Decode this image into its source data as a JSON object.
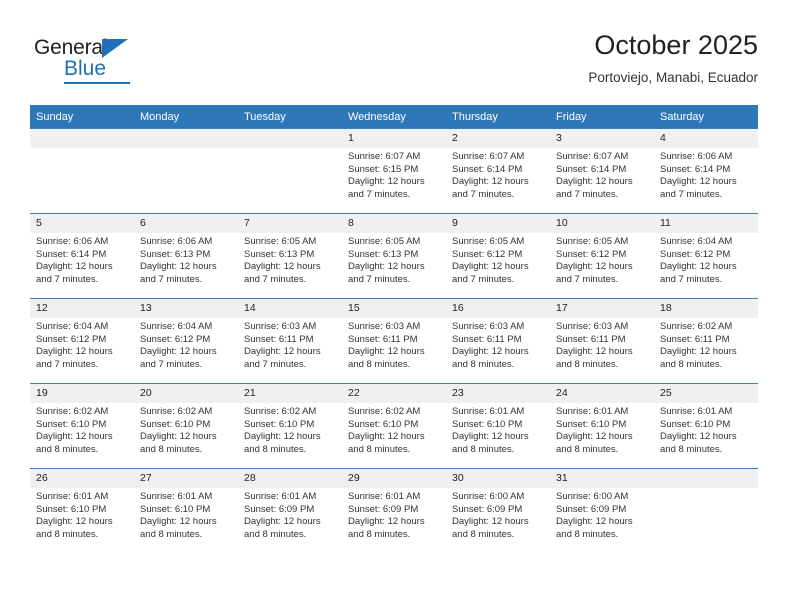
{
  "brand": {
    "word_one": "General",
    "word_two": "Blue",
    "accent_color": "#1f70b8"
  },
  "header": {
    "title": "October 2025",
    "subtitle": "Portoviejo, Manabi, Ecuador"
  },
  "theme": {
    "header_row_bg": "#2e77b9",
    "daynum_bg": "#f0f0f0",
    "text_color": "#333333"
  },
  "labels": {
    "sunrise_prefix": "Sunrise:",
    "sunset_prefix": "Sunset:",
    "daylight_prefix": "Daylight:"
  },
  "weekdays": [
    "Sunday",
    "Monday",
    "Tuesday",
    "Wednesday",
    "Thursday",
    "Friday",
    "Saturday"
  ],
  "weeks": [
    [
      {
        "day": "",
        "blank": true,
        "sunrise": "",
        "sunset": "",
        "daylight": ""
      },
      {
        "day": "",
        "blank": true,
        "sunrise": "",
        "sunset": "",
        "daylight": ""
      },
      {
        "day": "",
        "blank": true,
        "sunrise": "",
        "sunset": "",
        "daylight": ""
      },
      {
        "day": "1",
        "blank": false,
        "sunrise": "Sunrise: 6:07 AM",
        "sunset": "Sunset: 6:15 PM",
        "daylight": "Daylight: 12 hours and 7 minutes."
      },
      {
        "day": "2",
        "blank": false,
        "sunrise": "Sunrise: 6:07 AM",
        "sunset": "Sunset: 6:14 PM",
        "daylight": "Daylight: 12 hours and 7 minutes."
      },
      {
        "day": "3",
        "blank": false,
        "sunrise": "Sunrise: 6:07 AM",
        "sunset": "Sunset: 6:14 PM",
        "daylight": "Daylight: 12 hours and 7 minutes."
      },
      {
        "day": "4",
        "blank": false,
        "sunrise": "Sunrise: 6:06 AM",
        "sunset": "Sunset: 6:14 PM",
        "daylight": "Daylight: 12 hours and 7 minutes."
      }
    ],
    [
      {
        "day": "5",
        "blank": false,
        "sunrise": "Sunrise: 6:06 AM",
        "sunset": "Sunset: 6:14 PM",
        "daylight": "Daylight: 12 hours and 7 minutes."
      },
      {
        "day": "6",
        "blank": false,
        "sunrise": "Sunrise: 6:06 AM",
        "sunset": "Sunset: 6:13 PM",
        "daylight": "Daylight: 12 hours and 7 minutes."
      },
      {
        "day": "7",
        "blank": false,
        "sunrise": "Sunrise: 6:05 AM",
        "sunset": "Sunset: 6:13 PM",
        "daylight": "Daylight: 12 hours and 7 minutes."
      },
      {
        "day": "8",
        "blank": false,
        "sunrise": "Sunrise: 6:05 AM",
        "sunset": "Sunset: 6:13 PM",
        "daylight": "Daylight: 12 hours and 7 minutes."
      },
      {
        "day": "9",
        "blank": false,
        "sunrise": "Sunrise: 6:05 AM",
        "sunset": "Sunset: 6:12 PM",
        "daylight": "Daylight: 12 hours and 7 minutes."
      },
      {
        "day": "10",
        "blank": false,
        "sunrise": "Sunrise: 6:05 AM",
        "sunset": "Sunset: 6:12 PM",
        "daylight": "Daylight: 12 hours and 7 minutes."
      },
      {
        "day": "11",
        "blank": false,
        "sunrise": "Sunrise: 6:04 AM",
        "sunset": "Sunset: 6:12 PM",
        "daylight": "Daylight: 12 hours and 7 minutes."
      }
    ],
    [
      {
        "day": "12",
        "blank": false,
        "sunrise": "Sunrise: 6:04 AM",
        "sunset": "Sunset: 6:12 PM",
        "daylight": "Daylight: 12 hours and 7 minutes."
      },
      {
        "day": "13",
        "blank": false,
        "sunrise": "Sunrise: 6:04 AM",
        "sunset": "Sunset: 6:12 PM",
        "daylight": "Daylight: 12 hours and 7 minutes."
      },
      {
        "day": "14",
        "blank": false,
        "sunrise": "Sunrise: 6:03 AM",
        "sunset": "Sunset: 6:11 PM",
        "daylight": "Daylight: 12 hours and 7 minutes."
      },
      {
        "day": "15",
        "blank": false,
        "sunrise": "Sunrise: 6:03 AM",
        "sunset": "Sunset: 6:11 PM",
        "daylight": "Daylight: 12 hours and 8 minutes."
      },
      {
        "day": "16",
        "blank": false,
        "sunrise": "Sunrise: 6:03 AM",
        "sunset": "Sunset: 6:11 PM",
        "daylight": "Daylight: 12 hours and 8 minutes."
      },
      {
        "day": "17",
        "blank": false,
        "sunrise": "Sunrise: 6:03 AM",
        "sunset": "Sunset: 6:11 PM",
        "daylight": "Daylight: 12 hours and 8 minutes."
      },
      {
        "day": "18",
        "blank": false,
        "sunrise": "Sunrise: 6:02 AM",
        "sunset": "Sunset: 6:11 PM",
        "daylight": "Daylight: 12 hours and 8 minutes."
      }
    ],
    [
      {
        "day": "19",
        "blank": false,
        "sunrise": "Sunrise: 6:02 AM",
        "sunset": "Sunset: 6:10 PM",
        "daylight": "Daylight: 12 hours and 8 minutes."
      },
      {
        "day": "20",
        "blank": false,
        "sunrise": "Sunrise: 6:02 AM",
        "sunset": "Sunset: 6:10 PM",
        "daylight": "Daylight: 12 hours and 8 minutes."
      },
      {
        "day": "21",
        "blank": false,
        "sunrise": "Sunrise: 6:02 AM",
        "sunset": "Sunset: 6:10 PM",
        "daylight": "Daylight: 12 hours and 8 minutes."
      },
      {
        "day": "22",
        "blank": false,
        "sunrise": "Sunrise: 6:02 AM",
        "sunset": "Sunset: 6:10 PM",
        "daylight": "Daylight: 12 hours and 8 minutes."
      },
      {
        "day": "23",
        "blank": false,
        "sunrise": "Sunrise: 6:01 AM",
        "sunset": "Sunset: 6:10 PM",
        "daylight": "Daylight: 12 hours and 8 minutes."
      },
      {
        "day": "24",
        "blank": false,
        "sunrise": "Sunrise: 6:01 AM",
        "sunset": "Sunset: 6:10 PM",
        "daylight": "Daylight: 12 hours and 8 minutes."
      },
      {
        "day": "25",
        "blank": false,
        "sunrise": "Sunrise: 6:01 AM",
        "sunset": "Sunset: 6:10 PM",
        "daylight": "Daylight: 12 hours and 8 minutes."
      }
    ],
    [
      {
        "day": "26",
        "blank": false,
        "sunrise": "Sunrise: 6:01 AM",
        "sunset": "Sunset: 6:10 PM",
        "daylight": "Daylight: 12 hours and 8 minutes."
      },
      {
        "day": "27",
        "blank": false,
        "sunrise": "Sunrise: 6:01 AM",
        "sunset": "Sunset: 6:10 PM",
        "daylight": "Daylight: 12 hours and 8 minutes."
      },
      {
        "day": "28",
        "blank": false,
        "sunrise": "Sunrise: 6:01 AM",
        "sunset": "Sunset: 6:09 PM",
        "daylight": "Daylight: 12 hours and 8 minutes."
      },
      {
        "day": "29",
        "blank": false,
        "sunrise": "Sunrise: 6:01 AM",
        "sunset": "Sunset: 6:09 PM",
        "daylight": "Daylight: 12 hours and 8 minutes."
      },
      {
        "day": "30",
        "blank": false,
        "sunrise": "Sunrise: 6:00 AM",
        "sunset": "Sunset: 6:09 PM",
        "daylight": "Daylight: 12 hours and 8 minutes."
      },
      {
        "day": "31",
        "blank": false,
        "sunrise": "Sunrise: 6:00 AM",
        "sunset": "Sunset: 6:09 PM",
        "daylight": "Daylight: 12 hours and 8 minutes."
      },
      {
        "day": "",
        "blank": true,
        "sunrise": "",
        "sunset": "",
        "daylight": ""
      }
    ]
  ]
}
